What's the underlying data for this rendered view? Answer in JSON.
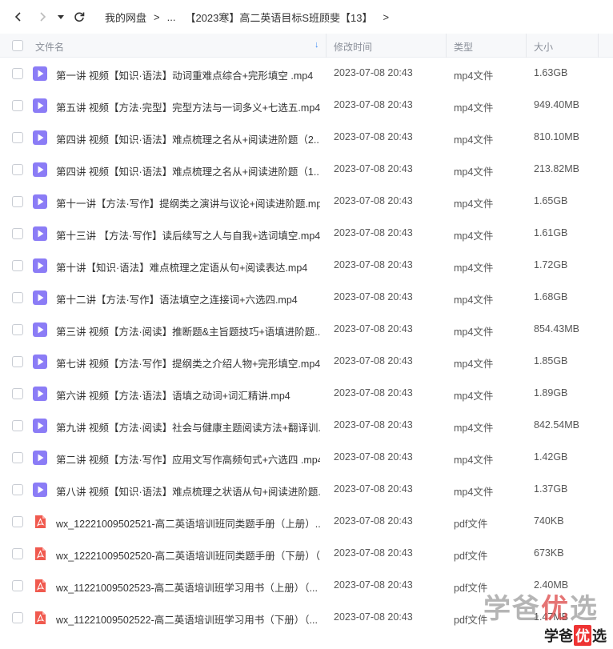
{
  "breadcrumb": {
    "root": "我的网盘",
    "ellipsis": "...",
    "current": "【2023寒】高二英语目标S班顾斐【13】"
  },
  "header": {
    "name": "文件名",
    "modified": "修改时间",
    "type": "类型",
    "size": "大小"
  },
  "files": [
    {
      "icon": "video",
      "name": "第一讲 视频【知识·语法】动词重难点综合+完形填空 .mp4",
      "time": "2023-07-08 20:43",
      "type": "mp4文件",
      "size": "1.63GB"
    },
    {
      "icon": "video",
      "name": "第五讲 视频【方法·完型】完型方法与一词多义+七选五.mp4",
      "time": "2023-07-08 20:43",
      "type": "mp4文件",
      "size": "949.40MB"
    },
    {
      "icon": "video",
      "name": "第四讲 视频【知识·语法】难点梳理之名从+阅读进阶题（2...",
      "time": "2023-07-08 20:43",
      "type": "mp4文件",
      "size": "810.10MB"
    },
    {
      "icon": "video",
      "name": "第四讲 视频【知识·语法】难点梳理之名从+阅读进阶题（1...",
      "time": "2023-07-08 20:43",
      "type": "mp4文件",
      "size": "213.82MB"
    },
    {
      "icon": "video",
      "name": "第十一讲【方法·写作】提纲类之演讲与议论+阅读进阶题.mp4",
      "time": "2023-07-08 20:43",
      "type": "mp4文件",
      "size": "1.65GB"
    },
    {
      "icon": "video",
      "name": "第十三讲 【方法·写作】读后续写之人与自我+选词填空.mp4",
      "time": "2023-07-08 20:43",
      "type": "mp4文件",
      "size": "1.61GB"
    },
    {
      "icon": "video",
      "name": "第十讲【知识·语法】难点梳理之定语从句+阅读表达.mp4",
      "time": "2023-07-08 20:43",
      "type": "mp4文件",
      "size": "1.72GB"
    },
    {
      "icon": "video",
      "name": "第十二讲【方法·写作】语法填空之连接词+六选四.mp4",
      "time": "2023-07-08 20:43",
      "type": "mp4文件",
      "size": "1.68GB"
    },
    {
      "icon": "video",
      "name": "第三讲 视频【方法·阅读】推断题&主旨题技巧+语填进阶题....",
      "time": "2023-07-08 20:43",
      "type": "mp4文件",
      "size": "854.43MB"
    },
    {
      "icon": "video",
      "name": "第七讲 视频【方法·写作】提纲类之介绍人物+完形填空.mp4",
      "time": "2023-07-08 20:43",
      "type": "mp4文件",
      "size": "1.85GB"
    },
    {
      "icon": "video",
      "name": "第六讲 视频【方法·语法】语填之动词+词汇精讲.mp4",
      "time": "2023-07-08 20:43",
      "type": "mp4文件",
      "size": "1.89GB"
    },
    {
      "icon": "video",
      "name": "第九讲 视频【方法·阅读】社会与健康主题阅读方法+翻译训...",
      "time": "2023-07-08 20:43",
      "type": "mp4文件",
      "size": "842.54MB"
    },
    {
      "icon": "video",
      "name": "第二讲 视频【方法·写作】应用文写作高频句式+六选四 .mp4",
      "time": "2023-07-08 20:43",
      "type": "mp4文件",
      "size": "1.42GB"
    },
    {
      "icon": "video",
      "name": "第八讲 视频【知识·语法】难点梳理之状语从句+阅读进阶题....",
      "time": "2023-07-08 20:43",
      "type": "mp4文件",
      "size": "1.37GB"
    },
    {
      "icon": "pdf",
      "name": "wx_12221009502521-高二英语培训班同类题手册（上册）...",
      "time": "2023-07-08 20:43",
      "type": "pdf文件",
      "size": "740KB"
    },
    {
      "icon": "pdf",
      "name": "wx_12221009502520-高二英语培训班同类题手册（下册）（...",
      "time": "2023-07-08 20:43",
      "type": "pdf文件",
      "size": "673KB"
    },
    {
      "icon": "pdf",
      "name": "wx_11221009502523-高二英语培训班学习用书（上册）（...",
      "time": "2023-07-08 20:43",
      "type": "pdf文件",
      "size": "2.40MB"
    },
    {
      "icon": "pdf",
      "name": "wx_11221009502522-高二英语培训班学习用书（下册）（...",
      "time": "2023-07-08 20:43",
      "type": "pdf文件",
      "size": "1.47MB"
    }
  ],
  "watermark": {
    "large": [
      "学",
      "爸",
      "优",
      "选"
    ],
    "small": [
      "学",
      "爸",
      "优",
      "选"
    ]
  },
  "colors": {
    "video_icon": "#8b7cf6",
    "pdf_icon": "#f05a4f",
    "accent": "#3f8cf6"
  }
}
